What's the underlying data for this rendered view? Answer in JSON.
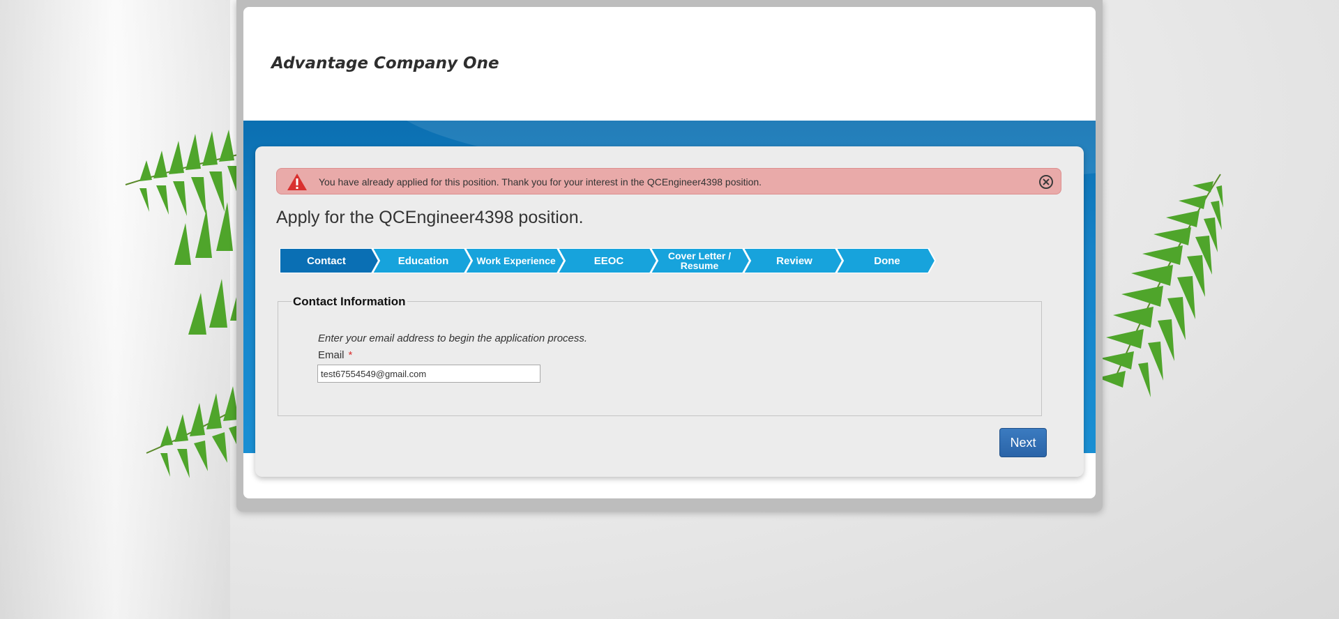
{
  "header": {
    "company_name": "Advantage Company One"
  },
  "alert": {
    "message": "You have already applied for this position. Thank you for your interest in the QCEngineer4398 position.",
    "icon": "warning-icon",
    "close_icon": "close-circle-icon",
    "background_color": "#e9aaa9"
  },
  "page_title": "Apply for the QCEngineer4398 position.",
  "steps": [
    {
      "label": "Contact",
      "active": true
    },
    {
      "label": "Education",
      "active": false
    },
    {
      "label": "Work Experience",
      "active": false
    },
    {
      "label": "EEOC",
      "active": false
    },
    {
      "label": "Cover Letter / Resume",
      "active": false
    },
    {
      "label": "Review",
      "active": false
    },
    {
      "label": "Done",
      "active": false
    }
  ],
  "colors": {
    "step_active": "#0a6fb4",
    "step_inactive": "#17a3dc",
    "primary_button": "#2f6db0"
  },
  "contact_section": {
    "legend": "Contact Information",
    "instructions": "Enter your email address to begin the application process.",
    "email_label": "Email",
    "required_marker": "*",
    "email_value": "test67554549@gmail.com"
  },
  "buttons": {
    "next_label": "Next"
  }
}
